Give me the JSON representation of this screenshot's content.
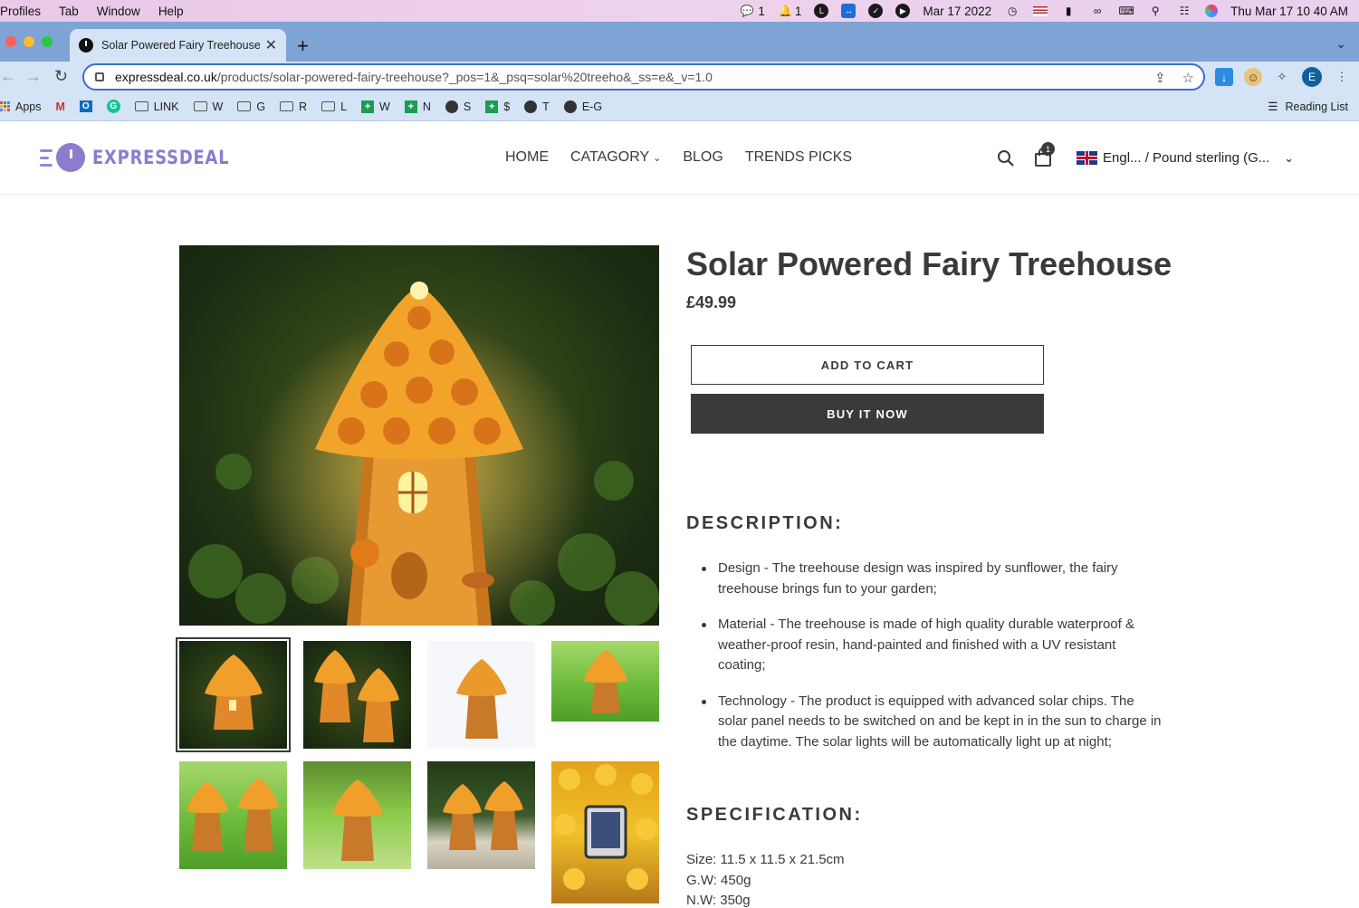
{
  "menubar": {
    "items": [
      "Profiles",
      "Tab",
      "Window",
      "Help"
    ],
    "status": {
      "wechat_count": "1",
      "notif_count": "1",
      "date": "Mar 17 2022",
      "clock": "Thu Mar 17  10 40 AM"
    }
  },
  "browser": {
    "tab_title": "Solar Powered Fairy Treehouse",
    "url_host": "expressdeal.co.uk",
    "url_path": "/products/solar-powered-fairy-treehouse?_pos=1&_psq=solar%20treeho&_ss=e&_v=1.0",
    "profile_initial": "E",
    "bookmarks": [
      "Apps",
      "LINK",
      "W",
      "G",
      "R",
      "L",
      "W",
      "N",
      "S",
      "$",
      "T",
      "E-G"
    ],
    "reading_list": "Reading List"
  },
  "site": {
    "logo_text": "EXPRESSDEAL",
    "nav": [
      "HOME",
      "CATAGORY",
      "BLOG",
      "TRENDS PICKS"
    ],
    "cart_count": "1",
    "locale": "Engl... / Pound sterling (G..."
  },
  "product": {
    "title": "Solar Powered Fairy Treehouse",
    "price": "£49.99",
    "add_to_cart": "ADD TO CART",
    "buy_now": "BUY IT NOW",
    "description_heading": "DESCRIPTION:",
    "description": [
      "Design - The treehouse design was inspired by sunflower, the fairy treehouse brings fun to your garden;",
      "Material - The treehouse is made of high quality durable waterproof & weather-proof resin, hand-painted and finished with a UV resistant coating;",
      "Technology - The product is equipped with advanced solar chips. The solar panel needs to be switched on and be kept in in the sun to charge in the daytime. The solar lights will be automatically light up at night;"
    ],
    "spec_heading": "SPECIFICATION:",
    "spec": [
      "Size: 11.5 x 11.5 x 21.5cm",
      "G.W: 450g",
      "N.W: 350g"
    ]
  },
  "colors": {
    "brand": "#8c7cd0",
    "text": "#3a3a3a",
    "chrome_tab": "#7ea4d6",
    "chrome_bar": "#d4e3f6"
  }
}
